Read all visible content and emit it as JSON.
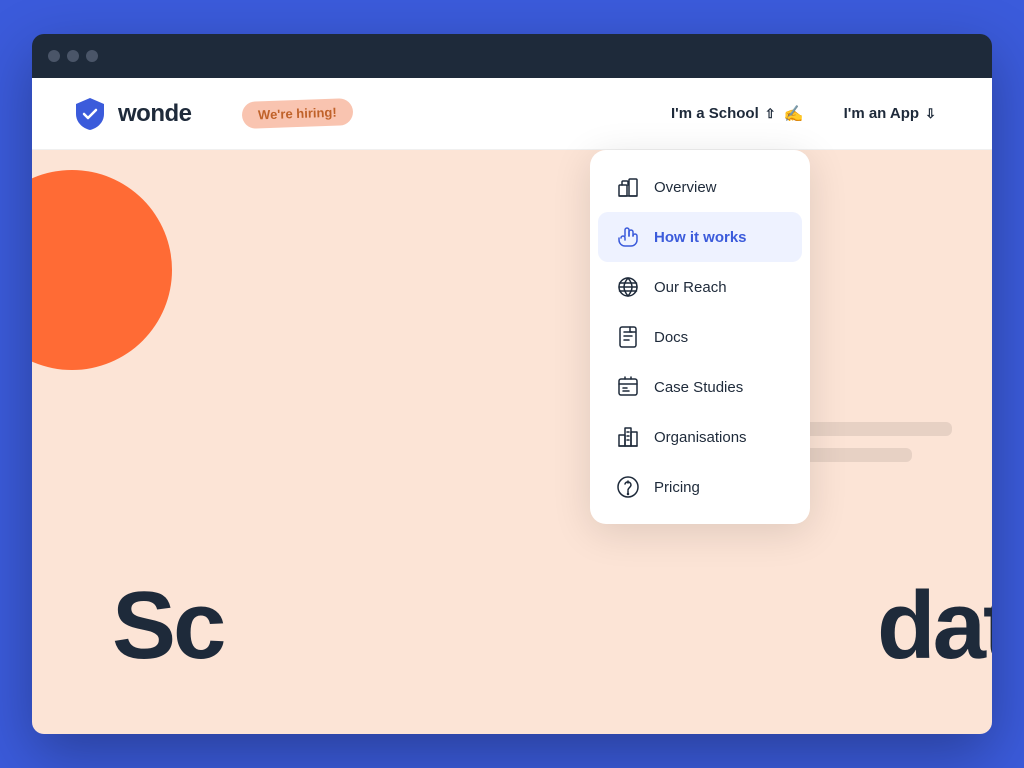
{
  "browser": {
    "titlebar": {
      "dots": [
        "dot1",
        "dot2",
        "dot3"
      ]
    }
  },
  "navbar": {
    "logo_text": "wonde",
    "hiring_badge": "We're hiring!",
    "nav_school_label": "I'm a School",
    "nav_app_label": "I'm an App"
  },
  "hero": {
    "text_left": "Sc",
    "text_right": "dat"
  },
  "dropdown": {
    "items": [
      {
        "id": "overview",
        "label": "Overview",
        "icon": "building-icon",
        "highlighted": false
      },
      {
        "id": "how-it-works",
        "label": "How it works",
        "icon": "hand-icon",
        "highlighted": true
      },
      {
        "id": "our-reach",
        "label": "Our Reach",
        "icon": "globe-icon",
        "highlighted": false
      },
      {
        "id": "docs",
        "label": "Docs",
        "icon": "docs-icon",
        "highlighted": false
      },
      {
        "id": "case-studies",
        "label": "Case Studies",
        "icon": "case-studies-icon",
        "highlighted": false
      },
      {
        "id": "organisations",
        "label": "Organisations",
        "icon": "organisations-icon",
        "highlighted": false
      },
      {
        "id": "pricing",
        "label": "Pricing",
        "icon": "pricing-icon",
        "highlighted": false
      }
    ]
  }
}
